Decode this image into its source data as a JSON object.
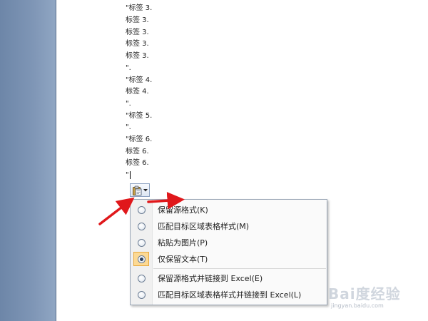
{
  "document": {
    "lines": [
      "\"标签 3.",
      "标签 3.",
      "标签 3.",
      "标签 3.",
      "标签 3.",
      "\".",
      "\"标签 4.",
      "标签 4.",
      "\".",
      "\"标签 5.",
      "\".",
      "\"标签 6.",
      "标签 6.",
      "标签 6.",
      "\""
    ]
  },
  "paste_button": {
    "icon": "clipboard-icon",
    "dropdown_icon": "chevron-down-icon"
  },
  "paste_menu": {
    "items": [
      {
        "label": "保留源格式(K)",
        "selected": false
      },
      {
        "label": "匹配目标区域表格样式(M)",
        "selected": false
      },
      {
        "label": "粘贴为图片(P)",
        "selected": false
      },
      {
        "label": "仅保留文本(T)",
        "selected": true
      },
      {
        "label": "保留源格式并链接到 Excel(E)",
        "selected": false
      },
      {
        "label": "匹配目标区域表格样式并链接到 Excel(L)",
        "selected": false
      }
    ]
  },
  "colors": {
    "arrow": "#e0181b",
    "selected_highlight": "#fcd994",
    "gutter": "#7f96b6"
  },
  "watermark": {
    "text": "Bai度经验",
    "sub": "jingyan.baidu.com"
  }
}
